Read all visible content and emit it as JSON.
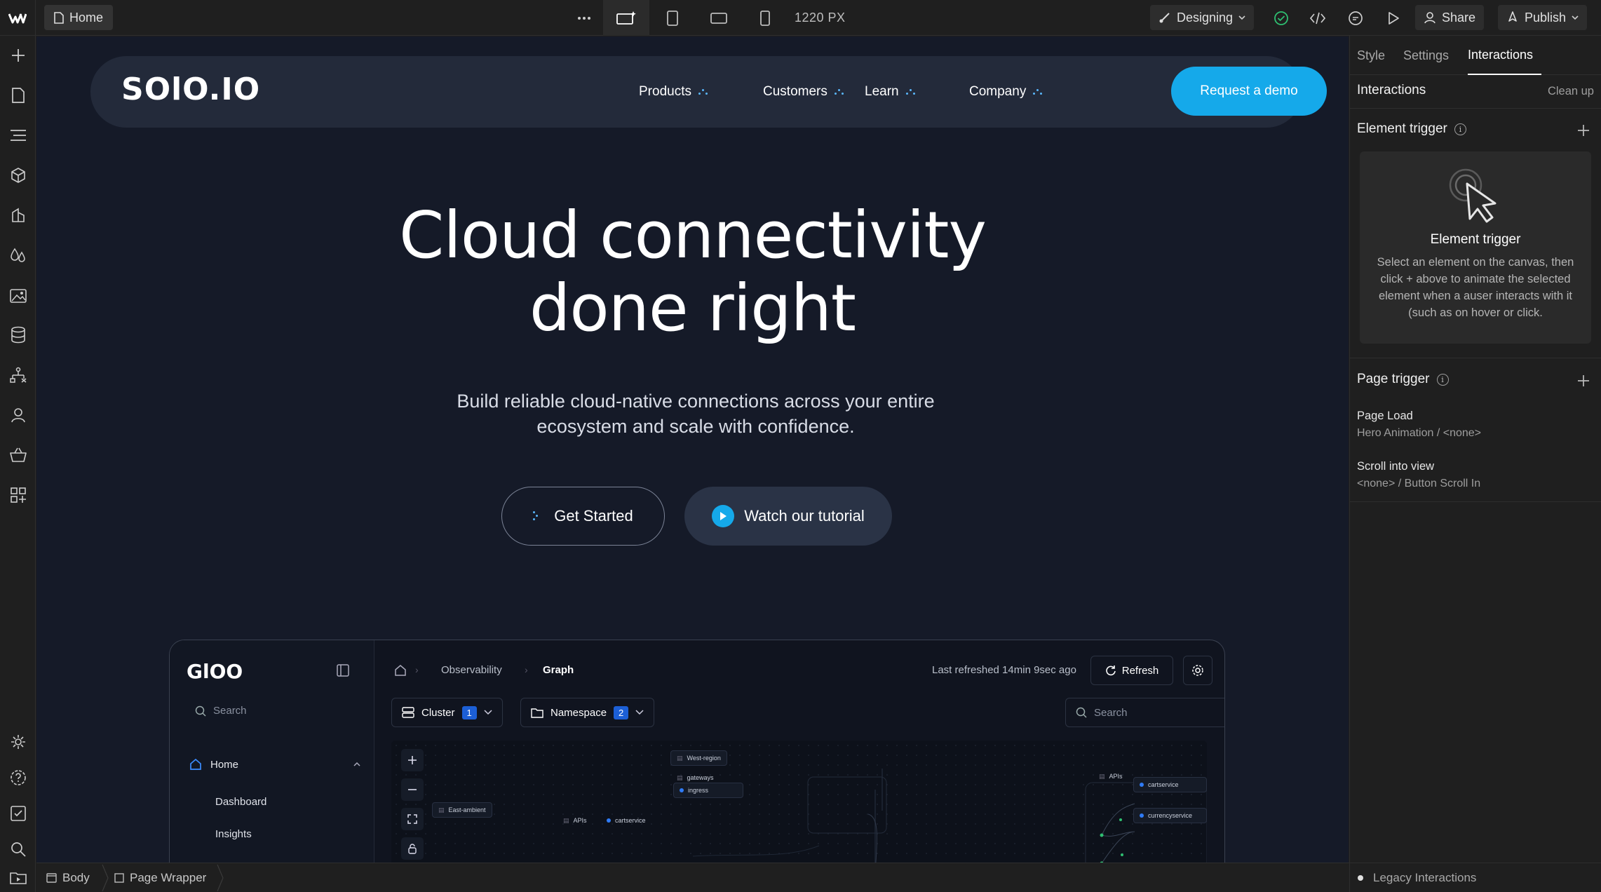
{
  "topbar": {
    "page_name": "Home",
    "viewport_width": "1220 PX",
    "mode_label": "Designing",
    "share_label": "Share",
    "publish_label": "Publish"
  },
  "canvas": {
    "brand": "SOlO.IO",
    "nav": [
      "Products",
      "Customers",
      "Learn",
      "Company"
    ],
    "cta": "Request a demo",
    "hero_title_line1": "Cloud connectivity",
    "hero_title_line2": "done right",
    "hero_sub": "Build reliable cloud-native connections across your entire ecosystem and scale with confidence.",
    "btn_primary": "Get Started",
    "btn_secondary": "Watch our tutorial",
    "accent": "#15a9ea"
  },
  "product": {
    "logo": "GlOO",
    "search_placeholder": "Search",
    "home": "Home",
    "sub_items": [
      "Dashboard",
      "Insights"
    ],
    "crumb_1": "Observability",
    "crumb_2": "Graph",
    "last_refreshed": "Last refreshed 14min 9sec ago",
    "refresh": "Refresh",
    "cluster": "Cluster",
    "cluster_count": "1",
    "namespace": "Namespace",
    "namespace_count": "2",
    "search2": "Search",
    "nodes": {
      "west_region": "West-region",
      "gateways": "gateways",
      "ingress": "ingress",
      "east_ambient": "East-ambient",
      "apis_1": "APIs",
      "cartservice_1": "cartservice",
      "apis_2": "APIs",
      "cartservice_2": "cartservice",
      "currencyservice": "currencyservice"
    }
  },
  "rpanel": {
    "tabs": [
      "Style",
      "Settings",
      "Interactions"
    ],
    "header": "Interactions",
    "clean_up": "Clean up",
    "element_trigger": "Element trigger",
    "card_title": "Element trigger",
    "card_desc": "Select an element on the canvas, then click + above to animate the selected element when a auser interacts with it (such as on hover or click.",
    "page_trigger": "Page trigger",
    "page_triggers": [
      {
        "name": "Page Load",
        "sub": "Hero Animation / <none>"
      },
      {
        "name": "Scroll into view",
        "sub": "<none> / Button Scroll In"
      }
    ]
  },
  "bottombar": {
    "crumbs": [
      "Body",
      "Page Wrapper"
    ],
    "legacy": "Legacy Interactions"
  }
}
